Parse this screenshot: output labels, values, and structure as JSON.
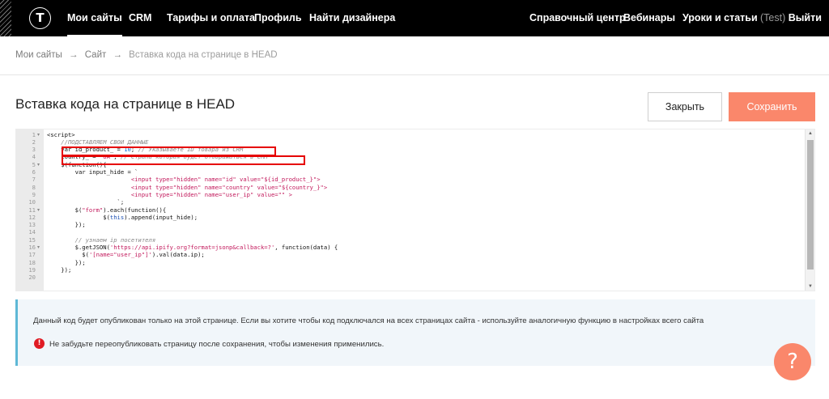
{
  "nav": {
    "logo": "T",
    "left": [
      "Мои сайты",
      "CRM",
      "Тарифы и оплата",
      "Профиль",
      "Найти дизайнера"
    ],
    "right": [
      "Справочный центр",
      "Вебинары",
      "Уроки и статьи"
    ],
    "user_tag": "(Test)",
    "logout": "Выйти"
  },
  "breadcrumb": [
    "Мои сайты",
    "→",
    "Сайт",
    "→",
    "Вставка кода на странице в HEAD"
  ],
  "page": {
    "title": "Вставка кода на странице в HEAD",
    "close_label": "Закрыть",
    "save_label": "Сохранить"
  },
  "editor": {
    "line_numbers": [
      "1",
      "2",
      "3",
      "4",
      "5",
      "6",
      "7",
      "8",
      "9",
      "10",
      "11",
      "12",
      "13",
      "14",
      "15",
      "16",
      "17",
      "18",
      "19",
      "20"
    ],
    "fold_lines": [
      1,
      5,
      11,
      16
    ],
    "lines": [
      [
        {
          "t": "<script>",
          "c": ""
        }
      ],
      [
        {
          "t": "    //ПОДСТАВЛЯЕМ СВОИ ДАННЫЕ",
          "c": "com"
        }
      ],
      [
        {
          "t": "    var id_product_ = ",
          "c": ""
        },
        {
          "t": "10",
          "c": "num"
        },
        {
          "t": "; ",
          "c": ""
        },
        {
          "t": "// Указываете ID товара из CRM",
          "c": "com"
        }
      ],
      [
        {
          "t": "    country_ = ",
          "c": ""
        },
        {
          "t": "\"UA\"",
          "c": "str"
        },
        {
          "t": "; ",
          "c": ""
        },
        {
          "t": "// Страна которая будет отображаться в CRM",
          "c": "com"
        }
      ],
      [
        {
          "t": "    $(function(){",
          "c": ""
        }
      ],
      [
        {
          "t": "        var input_hide = `",
          "c": ""
        }
      ],
      [
        {
          "t": "                        <input type=\"hidden\" name=\"id\" value=\"${id_product_}\">",
          "c": "str"
        }
      ],
      [
        {
          "t": "                        <input type=\"hidden\" name=\"country\" value=\"${country_}\">",
          "c": "str"
        }
      ],
      [
        {
          "t": "                        <input type=\"hidden\" name=\"user_ip\" value=\"\" >",
          "c": "str"
        }
      ],
      [
        {
          "t": "                    `;",
          "c": ""
        }
      ],
      [
        {
          "t": "        $(",
          "c": ""
        },
        {
          "t": "\"form\"",
          "c": "str"
        },
        {
          "t": ").each(function(){",
          "c": ""
        }
      ],
      [
        {
          "t": "                $(",
          "c": ""
        },
        {
          "t": "this",
          "c": "this"
        },
        {
          "t": ").append(input_hide);",
          "c": ""
        }
      ],
      [
        {
          "t": "        });",
          "c": ""
        }
      ],
      [
        {
          "t": "",
          "c": ""
        }
      ],
      [
        {
          "t": "        ",
          "c": ""
        },
        {
          "t": "// узнаем ip посетителя",
          "c": "com"
        }
      ],
      [
        {
          "t": "        $.getJSON(",
          "c": ""
        },
        {
          "t": "'https://api.ipify.org?format=jsonp&callback=?'",
          "c": "str"
        },
        {
          "t": ", function(data) {",
          "c": ""
        }
      ],
      [
        {
          "t": "          $(",
          "c": ""
        },
        {
          "t": "'[name=\"user_ip\"]'",
          "c": "str"
        },
        {
          "t": ").val(data.ip);",
          "c": ""
        }
      ],
      [
        {
          "t": "        });",
          "c": ""
        }
      ],
      [
        {
          "t": "    });",
          "c": ""
        }
      ],
      [
        {
          "t": "",
          "c": ""
        }
      ]
    ]
  },
  "info": {
    "text": "Данный код будет опубликован только на этой странице. Если вы хотите чтобы код подключался на всех страницах сайта - используйте аналогичную функцию в настройках всего сайта",
    "warning_icon": "!",
    "warning": "Не забудьте переопубликовать страницу после сохранения, чтобы изменения применились."
  },
  "help": {
    "label": "?"
  },
  "colors": {
    "accent": "#fa876b",
    "topbar": "#000000",
    "info_border": "#5eb8d6",
    "warning": "#e01b24",
    "highlight": "#e60000"
  }
}
